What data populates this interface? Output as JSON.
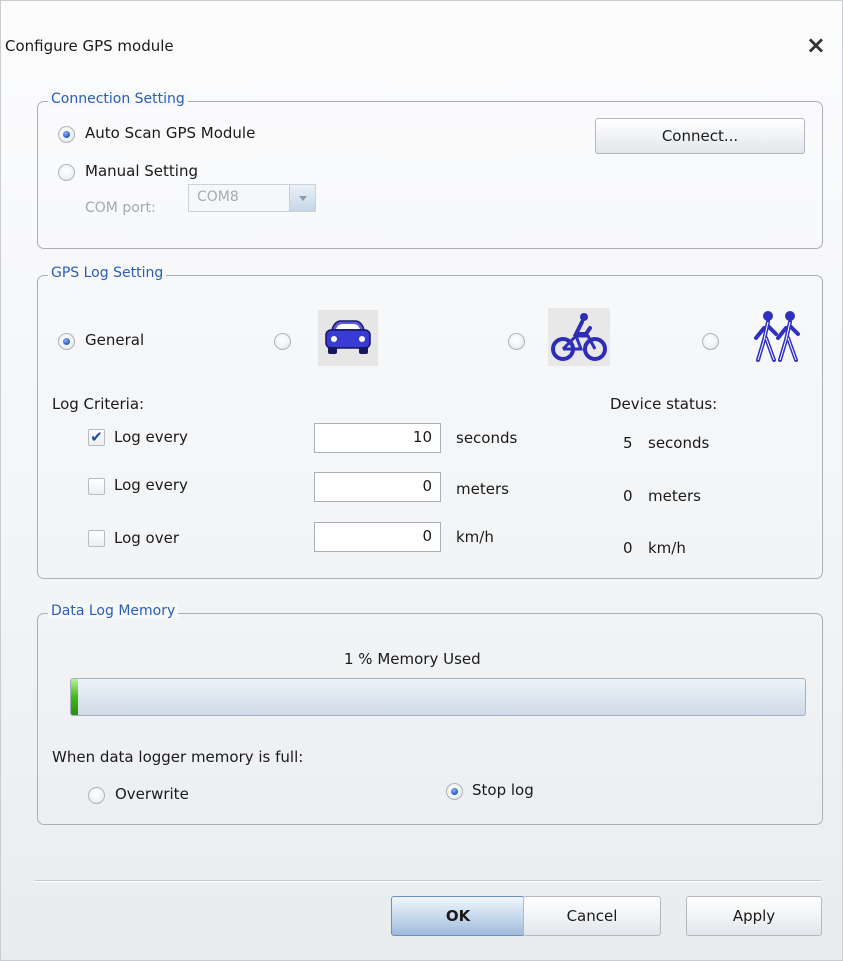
{
  "dialog": {
    "title": "Configure GPS module",
    "close_icon": "×"
  },
  "connection": {
    "legend": "Connection Setting",
    "auto_scan_label": "Auto Scan GPS Module",
    "manual_label": "Manual Setting",
    "com_port_label": "COM port:",
    "com_port_value": "COM8",
    "connect_button": "Connect..."
  },
  "gps_log": {
    "legend": "GPS Log Setting",
    "modes": [
      "General",
      "car-icon",
      "bicycle-icon",
      "hiking-icon"
    ],
    "general_label": "General",
    "log_criteria_label": "Log Criteria:",
    "device_status_label": "Device status:",
    "rows": [
      {
        "label": "Log every",
        "checked": true,
        "value": "10",
        "unit": "seconds",
        "status_value": "5",
        "status_unit": "seconds"
      },
      {
        "label": "Log every",
        "checked": false,
        "value": "0",
        "unit": "meters",
        "status_value": "0",
        "status_unit": "meters"
      },
      {
        "label": "Log over",
        "checked": false,
        "value": "0",
        "unit": "km/h",
        "status_value": "0",
        "status_unit": "km/h"
      }
    ]
  },
  "memory": {
    "legend": "Data Log Memory",
    "used_text": "1 % Memory Used",
    "used_percent": 1,
    "when_full_label": "When data logger memory is full:",
    "overwrite_label": "Overwrite",
    "stop_label": "Stop log"
  },
  "footer": {
    "ok": "OK",
    "cancel": "Cancel",
    "apply": "Apply"
  },
  "colors": {
    "legend": "#2a5db8",
    "progress_fill": "#3fb81c",
    "radio_selected": "#2b63c6"
  }
}
